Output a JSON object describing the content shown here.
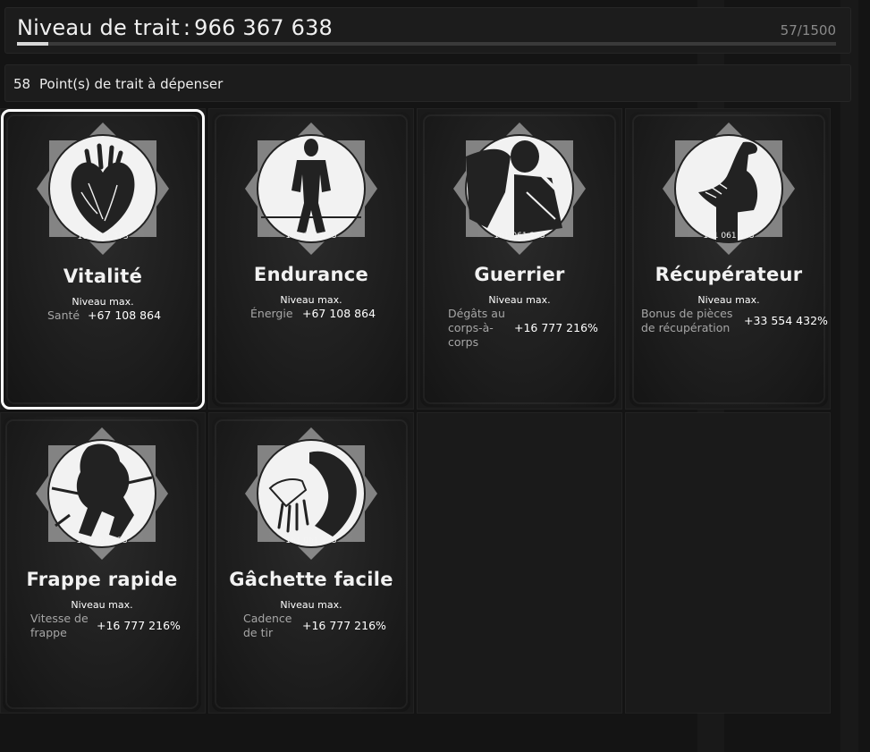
{
  "header": {
    "title_label": "Niveau de trait",
    "title_separator": ":",
    "title_value": "966 367 638",
    "progress_text": "57/1500",
    "progress_fraction": 0.038
  },
  "points": {
    "count": "58",
    "label": "Point(s) de trait à dépenser"
  },
  "colors": {
    "background": "#141414",
    "panel": "#1c1c1c",
    "card": "#1e1e1e",
    "selected_border": "#ffffff",
    "stat_name": "#a6a6a6",
    "stat_value": "#ffffff"
  },
  "cards": [
    {
      "title": "Vitalité",
      "emblem_number": "161 061 273",
      "emblem_icon": "heart-icon",
      "level": "Niveau max.",
      "stat_name": "Santé",
      "stat_value": "+67 108 864",
      "selected": true
    },
    {
      "title": "Endurance",
      "emblem_number": "161 061 273",
      "emblem_icon": "runner-icon",
      "level": "Niveau max.",
      "stat_name": "Énergie",
      "stat_value": "+67 108 864",
      "selected": false
    },
    {
      "title": "Guerrier",
      "emblem_number": "161 061 273",
      "emblem_icon": "warrior-icon",
      "level": "Niveau max.",
      "stat_name": "Dégâts au corps-à-corps",
      "stat_value": "+16 777 216%",
      "selected": false
    },
    {
      "title": "Récupérateur",
      "emblem_number": "161 061 273",
      "emblem_icon": "vulture-icon",
      "level": "Niveau max.",
      "stat_name": "Bonus de pièces de récupération",
      "stat_value": "+33 554 432%",
      "selected": false
    },
    {
      "title": "Frappe rapide",
      "emblem_number": "161 061 273",
      "emblem_icon": "fighter-icon",
      "level": "Niveau max.",
      "stat_name": "Vitesse de frappe",
      "stat_value": "+16 777 216%",
      "selected": false
    },
    {
      "title": "Gâchette facile",
      "emblem_number": "161 061 273",
      "emblem_icon": "trigger-hand-icon",
      "level": "Niveau max.",
      "stat_name": "Cadence de tir",
      "stat_value": "+16 777 216%",
      "selected": false
    }
  ]
}
